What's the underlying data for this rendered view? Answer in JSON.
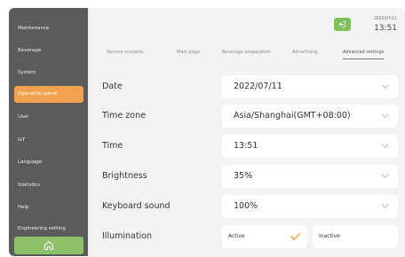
{
  "sidebar": {
    "items": [
      {
        "label": "Maintenance",
        "active": false
      },
      {
        "label": "Beverage",
        "active": false
      },
      {
        "label": "System",
        "active": false
      },
      {
        "label": "Operation panel",
        "active": true
      },
      {
        "label": "User",
        "active": false
      },
      {
        "label": "IoT",
        "active": false
      },
      {
        "label": "Language",
        "active": false
      },
      {
        "label": "Statistics",
        "active": false
      },
      {
        "label": "Help",
        "active": false
      },
      {
        "label": "Engineering setting",
        "active": false
      }
    ],
    "home_icon": "home-icon"
  },
  "header": {
    "exit_icon": "exit-icon",
    "date": "2022/07/11",
    "time": "13:51"
  },
  "tabs": [
    {
      "label": "Service scenario",
      "active": false
    },
    {
      "label": "Main page",
      "active": false
    },
    {
      "label": "Beverage preparation",
      "active": false
    },
    {
      "label": "Advertising",
      "active": false
    },
    {
      "label": "Advanced settings",
      "active": true
    }
  ],
  "settings": {
    "date": {
      "label": "Date",
      "value": "2022/07/11"
    },
    "timezone": {
      "label": "Time zone",
      "value": "Asia/Shanghai(GMT+08:00)"
    },
    "time": {
      "label": "Time",
      "value": "13:51"
    },
    "brightness": {
      "label": "Brightness",
      "value": "35%"
    },
    "keyboard_sound": {
      "label": "Keyboard sound",
      "value": "100%"
    },
    "illumination": {
      "label": "Illumination",
      "options": [
        "Active",
        "Inactive"
      ],
      "selected": "Active"
    }
  },
  "colors": {
    "sidebar_bg": "#5b5b5b",
    "active_accent": "#f2a24f",
    "green_accent": "#7fc05b",
    "check_color": "#f2a24f"
  }
}
